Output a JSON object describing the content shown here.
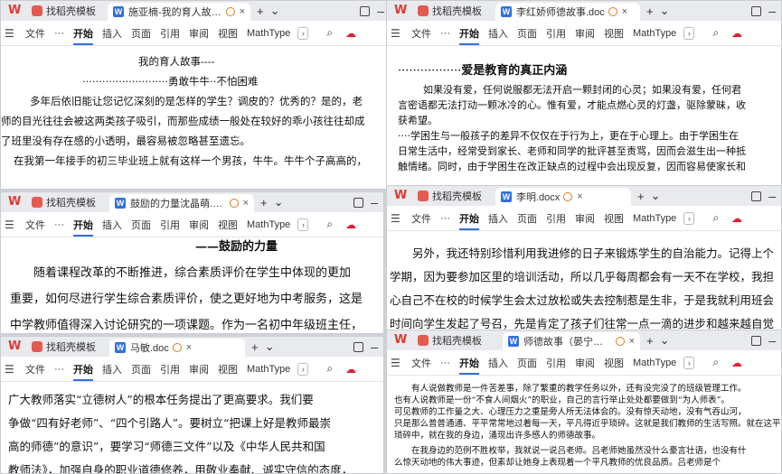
{
  "ribbon": {
    "file": "文件",
    "more": "···",
    "home": "开始",
    "insert": "插入",
    "page": "页面",
    "ref": "引用",
    "review": "审阅",
    "view": "视图",
    "mathtype": "MathType"
  },
  "tpl_tab": "找稻壳模板",
  "w1": {
    "doc_tab": "施亚楠-我的育人故事-...",
    "lines": [
      "我的育人故事----",
      "··························勇敢牛牛··不怕困难",
      "多年后依旧能让您记忆深刻的是怎样的学生？调皮的？优秀的？是的，老",
      "师的目光往往会被这两类孩子吸引，而那些成绩一般处在较好的乖小孩往往却成",
      "了班里没有存在感的小透明，最容易被忽略甚至遗忘。",
      "在我第一年接手的初三毕业班上就有这样一个男孩，牛牛。牛牛个子高高的，"
    ]
  },
  "w2": {
    "doc_tab": "李红娇师德故事.doc",
    "heading_dots": "·················",
    "heading": "爱是教育的真正内涵",
    "lines": [
      "如果没有爱，任何说服都无法开启一颗封闭的心灵；如果没有爱，任何君",
      "言密语都无法打动一颗冰冷的心。惟有爱，才能点燃心灵的灯盏，驱除蒙昧，收",
      "获希望。",
      "····学困生与一般孩子的差异不仅仅在于行为上，更在于心理上。由于学困生在",
      "日常生活中，经常受到家长、老师和同学的批评甚至责骂，因而会滋生出一种抵",
      "触情绪。同时，由于学困生在改正缺点的过程中会出现反复，因而容易使家长和"
    ]
  },
  "w3": {
    "doc_tab": "鼓励的力量沈晶萌.docx",
    "heading": "——鼓励的力量",
    "lines": [
      "随着课程改革的不断推进，综合素质评价在学生中体现的更加",
      "重要，如何尽进行学生综合素质评价，使之更好地为中考服务，这是",
      "中学教师值得深入讨论研究的一项课题。作为一名初中年级班主任，"
    ]
  },
  "w4": {
    "doc_tab": "李明.docx",
    "lines": [
      "另外，我还特别珍惜利用我进修的日子来锻炼学生的自治能力。记得上个",
      "学期，因为要参加区里的培训活动，所以几乎每周都会有一天不在学校，我担",
      "心自己不在校的时候学生会太过放松或失去控制惹是生非，于是我就利用班会",
      "时间向学生发起了号召，先是肯定了孩子们往常一点一滴的进步和越来越自觉"
    ]
  },
  "w5": {
    "doc_tab": "马敏.doc",
    "lines": [
      "广大教师落实“立德树人”的根本任务提出了更高要求。我们要",
      "争做“四有好老师”、“四个引路人”。要树立“把课上好是教师最崇",
      "高的师德”的意识”，要学习“师德三文件”以及《中华人民共和国",
      "教师法》，加强自身的职业道德修养，用敬业奉献、诚实守信的态度，"
    ]
  },
  "w6": {
    "doc_tab": "师德故事（晏宁初三）.do...",
    "lines": [
      "有人说做教师是一件苦差事，除了繁重的教学任务以外，还有没完没了的班级管理工作。",
      "也有人说教师是一份“不食人间烟火”的职业，自己的言行举止处处都要做到“为人师表”。",
      "可见教师的工作量之大、心理压力之重是旁人所无法体会的。没有惊天动地，没有气吞山河，",
      "只是那么普普通通、平平常常地过着每一天，平凡得近乎琐碎。这就是我们教师的生活写照。就在这平淡",
      "琐碎中，就在我的身边，涌现出许多感人的师德故事。",
      "在我身边的范例不胜枚举，我就说一说吕老师。吕老师她虽然没什么豪言壮语，也没有什",
      "么惊天动地的伟大事迹，但素却让她身上表现着一个平凡教师的优良品质。吕老师是个"
    ]
  }
}
